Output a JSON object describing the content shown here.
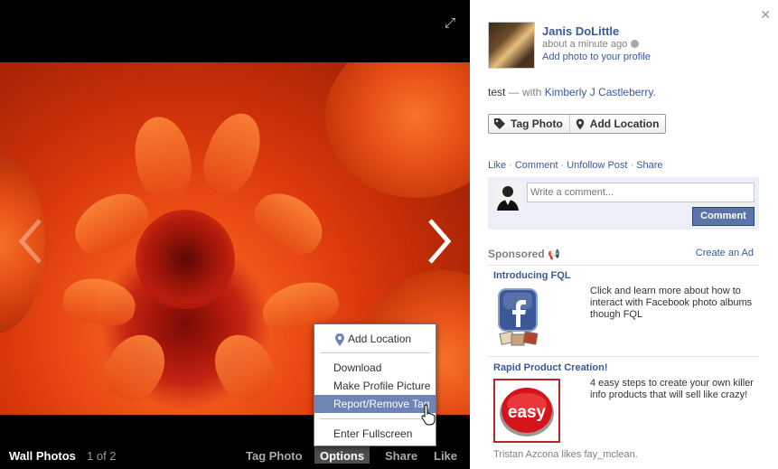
{
  "photo_viewer": {
    "album_title": "Wall Photos",
    "counter": "1 of 2",
    "bottom_buttons": {
      "tag_photo": "Tag Photo",
      "options": "Options",
      "share": "Share",
      "like": "Like"
    },
    "options_menu": {
      "items": [
        "Add Location",
        "Download",
        "Make Profile Picture",
        "Report/Remove Tag",
        "Enter Fullscreen"
      ],
      "highlighted": "Report/Remove Tag"
    }
  },
  "post": {
    "owner_name": "Janis DoLittle",
    "timestamp": "about a minute ago",
    "add_photo_link": "Add photo to your profile",
    "caption_text": "test",
    "caption_with": "— with",
    "tagged_person": "Kimberly J Castleberry.",
    "tag_buttons": {
      "tag_photo": "Tag Photo",
      "add_location": "Add Location"
    },
    "actions": [
      "Like",
      "Comment",
      "Unfollow Post",
      "Share"
    ],
    "comment_placeholder": "Write a comment...",
    "comment_button": "Comment"
  },
  "sponsored": {
    "title": "Sponsored",
    "create_ad": "Create an Ad",
    "ads": [
      {
        "title": "Introducing FQL",
        "body": "Click and learn more about how to interact with Facebook photo albums though FQL"
      },
      {
        "title": "Rapid Product Creation!",
        "body": "4 easy steps to create your own killer info products that will sell like crazy!",
        "image_text": "easy"
      }
    ],
    "social_line": "Tristan Azcona likes fay_mclean."
  },
  "colors": {
    "facebook_blue": "#3b5998",
    "menu_highlight": "#6d84b4",
    "button_blue": "#5b74a8"
  }
}
